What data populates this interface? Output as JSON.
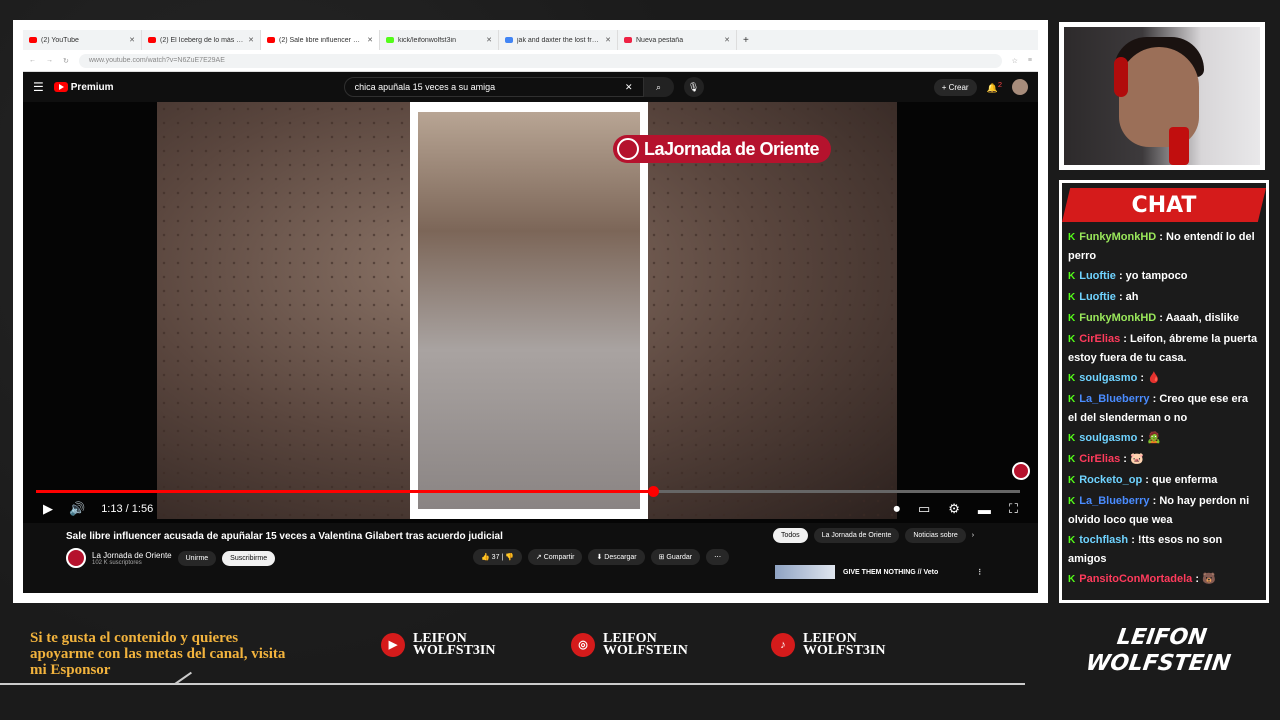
{
  "browser": {
    "tabs": [
      {
        "label": "(2) YouTube",
        "active": false
      },
      {
        "label": "(2) El Iceberg de lo más Perturb",
        "active": false
      },
      {
        "label": "(2) Sale libre influencer acusad",
        "active": true
      },
      {
        "label": "kick/leifonwolfst3in",
        "active": false
      },
      {
        "label": "jak and daxter the lost frontier -",
        "active": false
      },
      {
        "label": "Nueva pestaña",
        "active": false
      }
    ],
    "url": "www.youtube.com/watch?v=N6ZuE7E29AE"
  },
  "youtube": {
    "logo_label": "Premium",
    "search_query": "chica apuñala 15 veces a su amiga",
    "create_label": "Crear",
    "notifications_count": "2",
    "overlay_brand": "LaJornada de Oriente",
    "time_current": "1:13",
    "time_total": "1:56",
    "progress_fraction": 0.627,
    "video_title": "Sale libre influencer acusada de apuñalar 15 veces a Valentina Gilabert tras acuerdo judicial",
    "channel_name": "La Jornada de Oriente",
    "subscribers": "102 K suscriptores",
    "join_label": "Unirme",
    "subscribe_label": "Suscribirme",
    "likes": "37",
    "share_label": "Compartir",
    "download_label": "Descargar",
    "save_label": "Guardar",
    "chips": [
      "Todos",
      "La Jornada de Oriente",
      "Noticias sobre"
    ],
    "suggested_title": "GIVE THEM NOTHING // Veto"
  },
  "chat": {
    "header": "CHAT",
    "messages": [
      {
        "user": "FunkyMonkHD",
        "text": " : No entendí lo del perro",
        "color": "#9ae85b"
      },
      {
        "user": "Luoftie",
        "text": " : yo tampoco",
        "color": "#6fd3ff"
      },
      {
        "user": "Luoftie",
        "text": " : ah",
        "color": "#6fd3ff"
      },
      {
        "user": "FunkyMonkHD",
        "text": " : Aaaah, dislike",
        "color": "#9ae85b"
      },
      {
        "user": "CirElias",
        "text": " : Leifon, ábreme la puerta estoy fuera de tu casa.",
        "color": "#ff3b5c"
      },
      {
        "user": "soulgasmo",
        "text": " : 🩸",
        "color": "#6fd3ff"
      },
      {
        "user": "La_Blueberry",
        "text": " : Creo que ese era el del slenderman o no",
        "color": "#4a8cff"
      },
      {
        "user": "soulgasmo",
        "text": " : 🧟",
        "color": "#6fd3ff"
      },
      {
        "user": "CirElias",
        "text": " : 🐷",
        "color": "#ff3b5c"
      },
      {
        "user": "Rocketo_op",
        "text": " : que enferma",
        "color": "#6fd3ff"
      },
      {
        "user": "La_Blueberry",
        "text": " : No hay perdon ni olvido loco que wea",
        "color": "#4a8cff"
      },
      {
        "user": "tochflash",
        "text": " : !tts esos no son amigos",
        "color": "#6fd3ff"
      },
      {
        "user": "PansitoConMortadela",
        "text": " : 🐻",
        "color": "#ff3b5c"
      }
    ]
  },
  "overlay": {
    "sponsor_text": "Si te gusta el contenido y quieres apoyarme con las metas del canal, visita mi Esponsor",
    "socials": [
      {
        "icon": "youtube-icon",
        "line1": "LEIFON",
        "line2": "WOLFST3IN"
      },
      {
        "icon": "instagram-icon",
        "line1": "LEIFON",
        "line2": "WOLFSTEIN"
      },
      {
        "icon": "tiktok-icon",
        "line1": "LEIFON",
        "line2": "WOLFST3IN"
      }
    ],
    "signature_top": "LEIFON",
    "signature_bottom": "WOLFSTEIN"
  },
  "colors": {
    "accent_red": "#d51b1b",
    "youtube_red": "#ff0000",
    "sponsor_gold": "#f2b33d"
  }
}
